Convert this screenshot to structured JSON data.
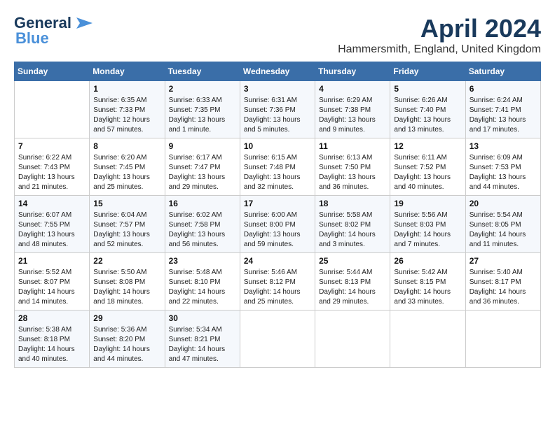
{
  "logo": {
    "general": "General",
    "blue": "Blue"
  },
  "title": "April 2024",
  "location": "Hammersmith, England, United Kingdom",
  "days_of_week": [
    "Sunday",
    "Monday",
    "Tuesday",
    "Wednesday",
    "Thursday",
    "Friday",
    "Saturday"
  ],
  "weeks": [
    [
      {
        "day": "",
        "sunrise": "",
        "sunset": "",
        "daylight": ""
      },
      {
        "day": "1",
        "sunrise": "Sunrise: 6:35 AM",
        "sunset": "Sunset: 7:33 PM",
        "daylight": "Daylight: 12 hours and 57 minutes."
      },
      {
        "day": "2",
        "sunrise": "Sunrise: 6:33 AM",
        "sunset": "Sunset: 7:35 PM",
        "daylight": "Daylight: 13 hours and 1 minute."
      },
      {
        "day": "3",
        "sunrise": "Sunrise: 6:31 AM",
        "sunset": "Sunset: 7:36 PM",
        "daylight": "Daylight: 13 hours and 5 minutes."
      },
      {
        "day": "4",
        "sunrise": "Sunrise: 6:29 AM",
        "sunset": "Sunset: 7:38 PM",
        "daylight": "Daylight: 13 hours and 9 minutes."
      },
      {
        "day": "5",
        "sunrise": "Sunrise: 6:26 AM",
        "sunset": "Sunset: 7:40 PM",
        "daylight": "Daylight: 13 hours and 13 minutes."
      },
      {
        "day": "6",
        "sunrise": "Sunrise: 6:24 AM",
        "sunset": "Sunset: 7:41 PM",
        "daylight": "Daylight: 13 hours and 17 minutes."
      }
    ],
    [
      {
        "day": "7",
        "sunrise": "Sunrise: 6:22 AM",
        "sunset": "Sunset: 7:43 PM",
        "daylight": "Daylight: 13 hours and 21 minutes."
      },
      {
        "day": "8",
        "sunrise": "Sunrise: 6:20 AM",
        "sunset": "Sunset: 7:45 PM",
        "daylight": "Daylight: 13 hours and 25 minutes."
      },
      {
        "day": "9",
        "sunrise": "Sunrise: 6:17 AM",
        "sunset": "Sunset: 7:47 PM",
        "daylight": "Daylight: 13 hours and 29 minutes."
      },
      {
        "day": "10",
        "sunrise": "Sunrise: 6:15 AM",
        "sunset": "Sunset: 7:48 PM",
        "daylight": "Daylight: 13 hours and 32 minutes."
      },
      {
        "day": "11",
        "sunrise": "Sunrise: 6:13 AM",
        "sunset": "Sunset: 7:50 PM",
        "daylight": "Daylight: 13 hours and 36 minutes."
      },
      {
        "day": "12",
        "sunrise": "Sunrise: 6:11 AM",
        "sunset": "Sunset: 7:52 PM",
        "daylight": "Daylight: 13 hours and 40 minutes."
      },
      {
        "day": "13",
        "sunrise": "Sunrise: 6:09 AM",
        "sunset": "Sunset: 7:53 PM",
        "daylight": "Daylight: 13 hours and 44 minutes."
      }
    ],
    [
      {
        "day": "14",
        "sunrise": "Sunrise: 6:07 AM",
        "sunset": "Sunset: 7:55 PM",
        "daylight": "Daylight: 13 hours and 48 minutes."
      },
      {
        "day": "15",
        "sunrise": "Sunrise: 6:04 AM",
        "sunset": "Sunset: 7:57 PM",
        "daylight": "Daylight: 13 hours and 52 minutes."
      },
      {
        "day": "16",
        "sunrise": "Sunrise: 6:02 AM",
        "sunset": "Sunset: 7:58 PM",
        "daylight": "Daylight: 13 hours and 56 minutes."
      },
      {
        "day": "17",
        "sunrise": "Sunrise: 6:00 AM",
        "sunset": "Sunset: 8:00 PM",
        "daylight": "Daylight: 13 hours and 59 minutes."
      },
      {
        "day": "18",
        "sunrise": "Sunrise: 5:58 AM",
        "sunset": "Sunset: 8:02 PM",
        "daylight": "Daylight: 14 hours and 3 minutes."
      },
      {
        "day": "19",
        "sunrise": "Sunrise: 5:56 AM",
        "sunset": "Sunset: 8:03 PM",
        "daylight": "Daylight: 14 hours and 7 minutes."
      },
      {
        "day": "20",
        "sunrise": "Sunrise: 5:54 AM",
        "sunset": "Sunset: 8:05 PM",
        "daylight": "Daylight: 14 hours and 11 minutes."
      }
    ],
    [
      {
        "day": "21",
        "sunrise": "Sunrise: 5:52 AM",
        "sunset": "Sunset: 8:07 PM",
        "daylight": "Daylight: 14 hours and 14 minutes."
      },
      {
        "day": "22",
        "sunrise": "Sunrise: 5:50 AM",
        "sunset": "Sunset: 8:08 PM",
        "daylight": "Daylight: 14 hours and 18 minutes."
      },
      {
        "day": "23",
        "sunrise": "Sunrise: 5:48 AM",
        "sunset": "Sunset: 8:10 PM",
        "daylight": "Daylight: 14 hours and 22 minutes."
      },
      {
        "day": "24",
        "sunrise": "Sunrise: 5:46 AM",
        "sunset": "Sunset: 8:12 PM",
        "daylight": "Daylight: 14 hours and 25 minutes."
      },
      {
        "day": "25",
        "sunrise": "Sunrise: 5:44 AM",
        "sunset": "Sunset: 8:13 PM",
        "daylight": "Daylight: 14 hours and 29 minutes."
      },
      {
        "day": "26",
        "sunrise": "Sunrise: 5:42 AM",
        "sunset": "Sunset: 8:15 PM",
        "daylight": "Daylight: 14 hours and 33 minutes."
      },
      {
        "day": "27",
        "sunrise": "Sunrise: 5:40 AM",
        "sunset": "Sunset: 8:17 PM",
        "daylight": "Daylight: 14 hours and 36 minutes."
      }
    ],
    [
      {
        "day": "28",
        "sunrise": "Sunrise: 5:38 AM",
        "sunset": "Sunset: 8:18 PM",
        "daylight": "Daylight: 14 hours and 40 minutes."
      },
      {
        "day": "29",
        "sunrise": "Sunrise: 5:36 AM",
        "sunset": "Sunset: 8:20 PM",
        "daylight": "Daylight: 14 hours and 44 minutes."
      },
      {
        "day": "30",
        "sunrise": "Sunrise: 5:34 AM",
        "sunset": "Sunset: 8:21 PM",
        "daylight": "Daylight: 14 hours and 47 minutes."
      },
      {
        "day": "",
        "sunrise": "",
        "sunset": "",
        "daylight": ""
      },
      {
        "day": "",
        "sunrise": "",
        "sunset": "",
        "daylight": ""
      },
      {
        "day": "",
        "sunrise": "",
        "sunset": "",
        "daylight": ""
      },
      {
        "day": "",
        "sunrise": "",
        "sunset": "",
        "daylight": ""
      }
    ]
  ]
}
